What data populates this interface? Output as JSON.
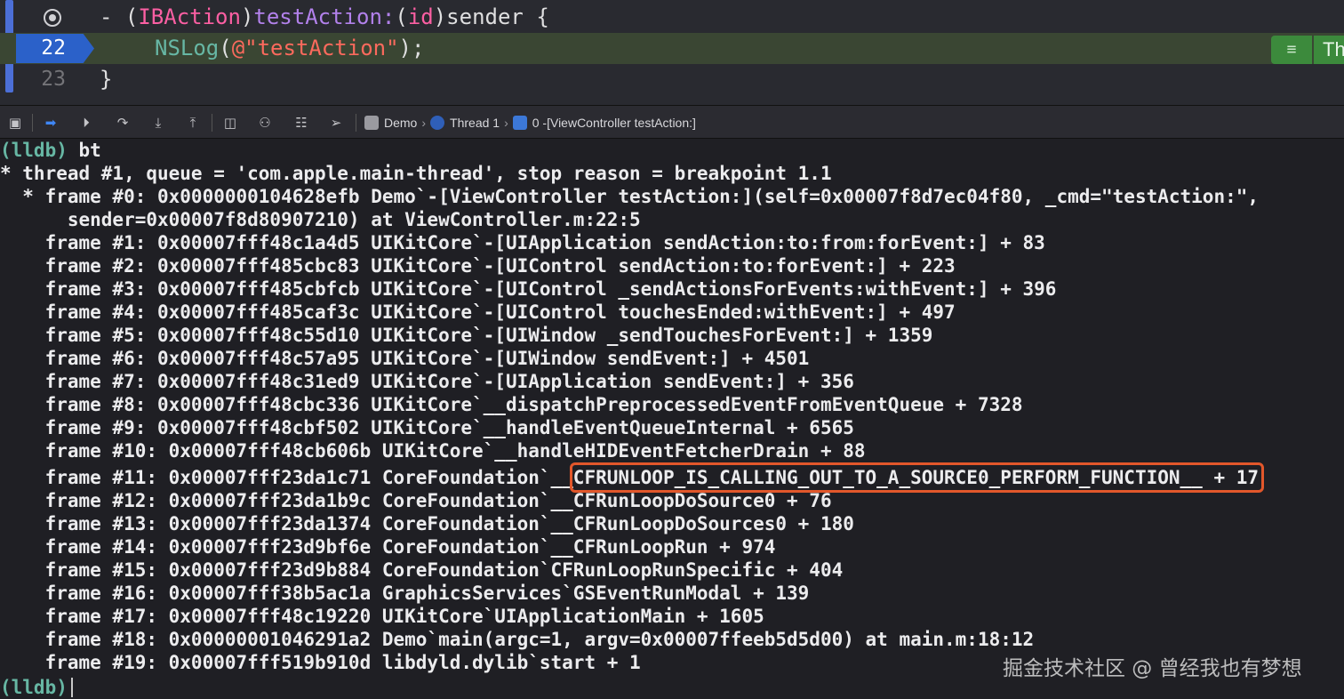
{
  "editor": {
    "lines": [
      {
        "number": "",
        "parts": [
          "- (",
          "IBAction",
          ")",
          "testAction:",
          "(",
          "id",
          ")sender {"
        ]
      },
      {
        "number": "22",
        "parts": [
          "NSLog",
          "(",
          "@\"testAction\"",
          ");"
        ]
      },
      {
        "number": "23",
        "parts": [
          "}"
        ]
      }
    ],
    "annotation_icon": "≡",
    "annotation_text": "Th"
  },
  "debug_bar": {
    "icons": [
      "hide-console-icon",
      "breakpoint-toggle-icon",
      "continue-icon",
      "step-over-icon",
      "step-into-icon",
      "step-out-icon",
      "view-debugger-icon",
      "memory-graph-icon",
      "environment-overrides-icon",
      "simulate-location-icon"
    ],
    "breadcrumb": [
      "Demo",
      "Thread 1",
      "0 -[ViewController testAction:]"
    ]
  },
  "console": {
    "lines": [
      "(lldb) bt",
      "* thread #1, queue = 'com.apple.main-thread', stop reason = breakpoint 1.1",
      "  * frame #0: 0x0000000104628efb Demo`-[ViewController testAction:](self=0x00007f8d7ec04f80, _cmd=\"testAction:\",",
      "      sender=0x00007f8d80907210) at ViewController.m:22:5",
      "    frame #1: 0x00007fff48c1a4d5 UIKitCore`-[UIApplication sendAction:to:from:forEvent:] + 83",
      "    frame #2: 0x00007fff485cbc83 UIKitCore`-[UIControl sendAction:to:forEvent:] + 223",
      "    frame #3: 0x00007fff485cbfcb UIKitCore`-[UIControl _sendActionsForEvents:withEvent:] + 396",
      "    frame #4: 0x00007fff485caf3c UIKitCore`-[UIControl touchesEnded:withEvent:] + 497",
      "    frame #5: 0x00007fff48c55d10 UIKitCore`-[UIWindow _sendTouchesForEvent:] + 1359",
      "    frame #6: 0x00007fff48c57a95 UIKitCore`-[UIWindow sendEvent:] + 4501",
      "    frame #7: 0x00007fff48c31ed9 UIKitCore`-[UIApplication sendEvent:] + 356",
      "    frame #8: 0x00007fff48cbc336 UIKitCore`__dispatchPreprocessedEventFromEventQueue + 7328",
      "    frame #9: 0x00007fff48cbf502 UIKitCore`__handleEventQueueInternal + 6565",
      "    frame #10: 0x00007fff48cb606b UIKitCore`__handleHIDEventFetcherDrain + 88",
      "    frame #11: 0x00007fff23da1c71 CoreFoundation`__CFRUNLOOP_IS_CALLING_OUT_TO_A_SOURCE0_PERFORM_FUNCTION__ + 17",
      "    frame #12: 0x00007fff23da1b9c CoreFoundation`__CFRunLoopDoSource0 + 76",
      "    frame #13: 0x00007fff23da1374 CoreFoundation`__CFRunLoopDoSources0 + 180",
      "    frame #14: 0x00007fff23d9bf6e CoreFoundation`__CFRunLoopRun + 974",
      "    frame #15: 0x00007fff23d9b884 CoreFoundation`CFRunLoopRunSpecific + 404",
      "    frame #16: 0x00007fff38b5ac1a GraphicsServices`GSEventRunModal + 139",
      "    frame #17: 0x00007fff48c19220 UIKitCore`UIApplicationMain + 1605",
      "    frame #18: 0x00000001046291a2 Demo`main(argc=1, argv=0x00007ffeeb5d5d00) at main.m:18:12",
      "    frame #19: 0x00007fff519b910d libdyld.dylib`start + 1"
    ],
    "prompt": "(lldb)"
  },
  "watermark": "掘金技术社区 @ 曾经我也有梦想",
  "colors": {
    "editor_bg": "#292a30",
    "console_bg": "#1f1f24",
    "keyword": "#fc5fa3",
    "function": "#67b7a4",
    "string": "#fc6a5d",
    "current_line_bg": "#3a4633",
    "highlight_box": "#e2572b"
  }
}
